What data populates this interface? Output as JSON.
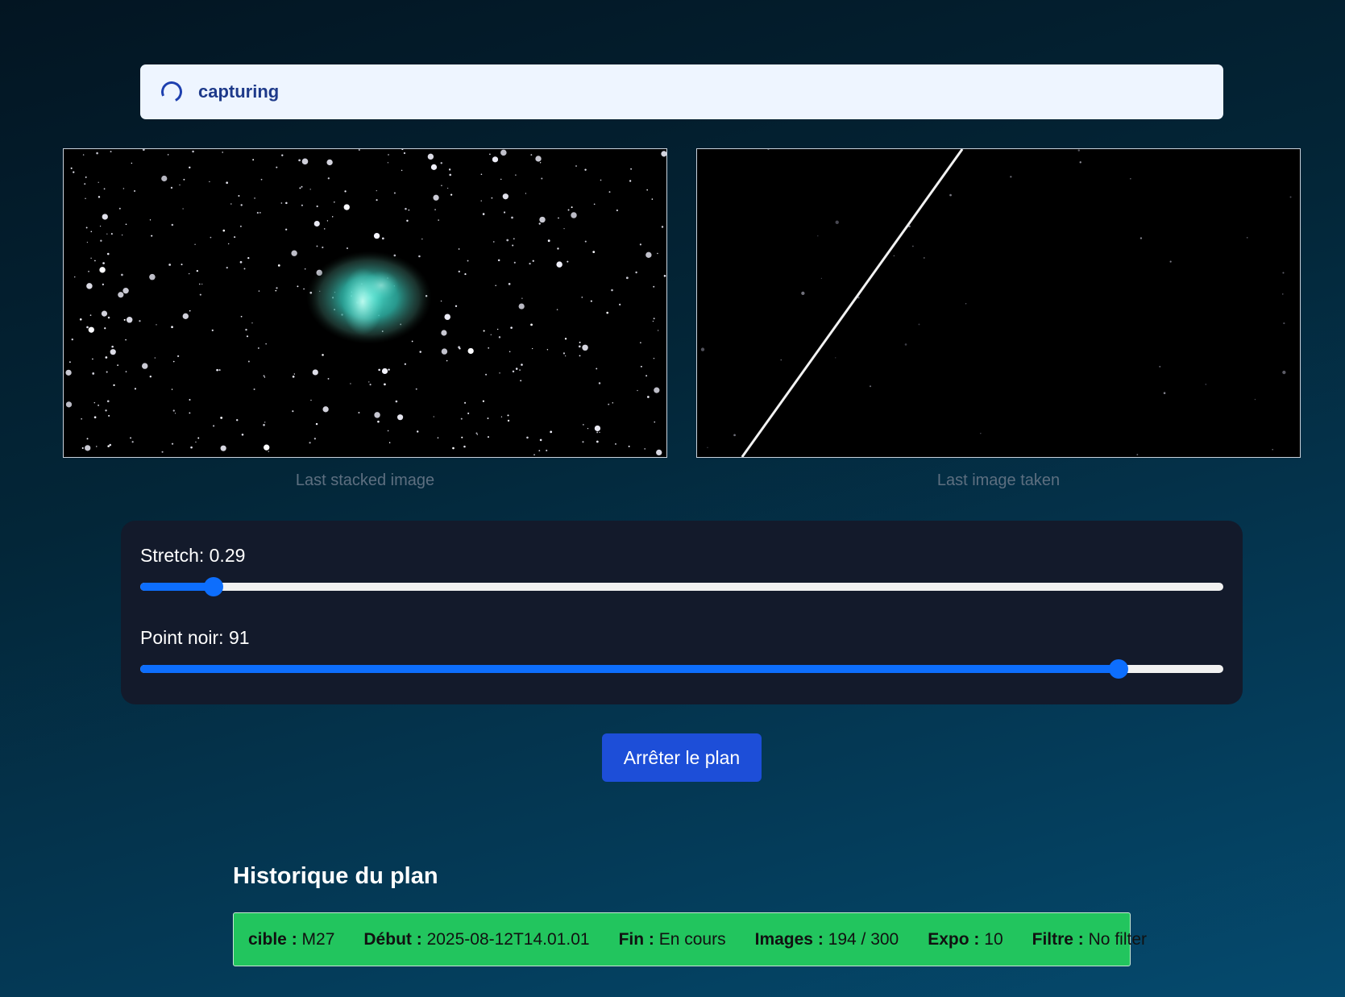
{
  "status": {
    "text": "capturing",
    "icon": "spinner-icon"
  },
  "images": {
    "stacked": {
      "caption": "Last stacked image"
    },
    "last": {
      "caption": "Last image taken"
    }
  },
  "sliders": {
    "stretch": {
      "label": "Stretch: 0.29",
      "fraction": 0.068
    },
    "black_point": {
      "label": "Point noir: 91",
      "fraction": 0.903
    }
  },
  "actions": {
    "stop_label": "Arrêter le plan"
  },
  "history": {
    "title": "Historique du plan",
    "rows": [
      {
        "target_label": "cible :",
        "target": "M27",
        "start_label": "Début :",
        "start": "2025-08-12T14.01.01",
        "end_label": "Fin :",
        "end": "En cours",
        "images_label": "Images :",
        "images": "194 / 300",
        "expo_label": "Expo :",
        "expo": "10",
        "filter_label": "Filtre :",
        "filter": "No filter"
      }
    ]
  },
  "colors": {
    "accent": "#0d6efd",
    "button": "#1d4ed8",
    "history_row": "#22c55e",
    "status_bg": "#eef5ff"
  }
}
